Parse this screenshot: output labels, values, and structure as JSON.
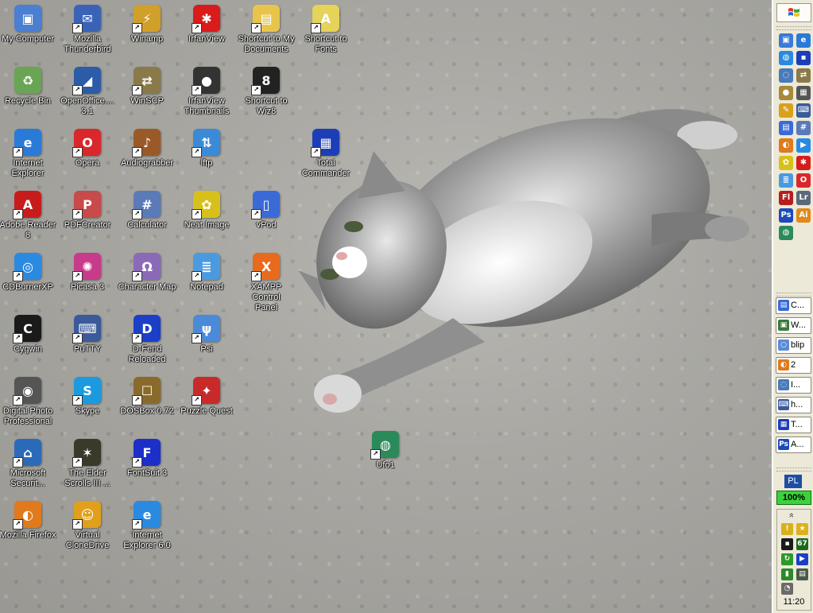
{
  "desktop": {
    "icons": [
      {
        "label": "My Computer",
        "icon": "my-computer-icon",
        "glyph": "▣",
        "color": "#4a7fd1"
      },
      {
        "label": "Mozilla\nThunderbird",
        "icon": "thunderbird-icon",
        "glyph": "✉",
        "color": "#3a63b8"
      },
      {
        "label": "Winamp",
        "icon": "winamp-icon",
        "glyph": "⚡",
        "color": "#d1a02a"
      },
      {
        "label": "IrfanView",
        "icon": "irfanview-icon",
        "glyph": "✱",
        "color": "#d81c1c"
      },
      {
        "label": "Shortcut to My\nDocuments",
        "icon": "folder-icon",
        "glyph": "▤",
        "color": "#e8c54a"
      },
      {
        "label": "Shortcut to\nFonts",
        "icon": "fonts-icon",
        "glyph": "A",
        "color": "#e5d35a"
      },
      {
        "label": "Recycle Bin",
        "icon": "recycle-bin-icon",
        "glyph": "♻",
        "color": "#6aa455"
      },
      {
        "label": "OpenOffice....\n3.1",
        "icon": "openoffice-icon",
        "glyph": "◢",
        "color": "#2c5ca8"
      },
      {
        "label": "WinSCP",
        "icon": "winscp-icon",
        "glyph": "⇄",
        "color": "#8a7a4a"
      },
      {
        "label": "IrfanView\nThumbnails",
        "icon": "panda-icon",
        "glyph": "●",
        "color": "#333333"
      },
      {
        "label": "Shortcut to\nWiz8",
        "icon": "wiz8-icon",
        "glyph": "8",
        "color": "#222222"
      },
      {
        "label": "Internet\nExplorer",
        "icon": "internet-explorer-icon",
        "glyph": "e",
        "color": "#2a7ad8"
      },
      {
        "label": "Opera",
        "icon": "opera-icon",
        "glyph": "O",
        "color": "#d8282c"
      },
      {
        "label": "Audiograbber",
        "icon": "audiograbber-icon",
        "glyph": "♪",
        "color": "#9a5a28"
      },
      {
        "label": "lftp",
        "icon": "lftp-icon",
        "glyph": "⇅",
        "color": "#3a8ad8"
      },
      {
        "label": "Total\nCommander",
        "icon": "total-commander-icon",
        "glyph": "▦",
        "color": "#1c3fb8"
      },
      {
        "label": "Adobe Reader\n8",
        "icon": "adobe-reader-icon",
        "glyph": "A",
        "color": "#c81c1c"
      },
      {
        "label": "PDFCreator",
        "icon": "pdfcreator-icon",
        "glyph": "P",
        "color": "#c84a4a"
      },
      {
        "label": "Calculator",
        "icon": "calculator-icon",
        "glyph": "#",
        "color": "#5a7ab8"
      },
      {
        "label": "Neat Image",
        "icon": "neat-image-icon",
        "glyph": "✿",
        "color": "#d8c01c"
      },
      {
        "label": "vPod",
        "icon": "vpod-icon",
        "glyph": "▯",
        "color": "#3a6ad8"
      },
      {
        "label": "CDBurnerXP",
        "icon": "cdburner-icon",
        "glyph": "◎",
        "color": "#2a8ae0"
      },
      {
        "label": "Picasa 3",
        "icon": "picasa-icon",
        "glyph": "✺",
        "color": "#c83a8a"
      },
      {
        "label": "Character Map",
        "icon": "character-map-icon",
        "glyph": "Ω",
        "color": "#8a6ab8"
      },
      {
        "label": "Notepad",
        "icon": "notepad-icon",
        "glyph": "≣",
        "color": "#4a9ae0"
      },
      {
        "label": "XAMPP Control\nPanel",
        "icon": "xampp-icon",
        "glyph": "X",
        "color": "#e86a1c"
      },
      {
        "label": "Cygwin",
        "icon": "cygwin-icon",
        "glyph": "C",
        "color": "#1a1a1a"
      },
      {
        "label": "PuTTY",
        "icon": "putty-icon",
        "glyph": "⌨",
        "color": "#3a5a9a"
      },
      {
        "label": "D-Fend\nReloaded",
        "icon": "dfend-icon",
        "glyph": "D",
        "color": "#1c3fc8"
      },
      {
        "label": "Psi",
        "icon": "psi-icon",
        "glyph": "ψ",
        "color": "#4a8ad8"
      },
      {
        "label": "Digital Photo\nProfessional",
        "icon": "camera-icon",
        "glyph": "◉",
        "color": "#555555"
      },
      {
        "label": "Skype",
        "icon": "skype-icon",
        "glyph": "S",
        "color": "#1c9ae0"
      },
      {
        "label": "DOSBox 0.72",
        "icon": "dosbox-icon",
        "glyph": "☐",
        "color": "#8a6a2a"
      },
      {
        "label": "Puzzle Quest",
        "icon": "puzzle-quest-icon",
        "glyph": "✦",
        "color": "#c82a2a"
      },
      {
        "label": "Ufo1",
        "icon": "ufo-icon",
        "glyph": "◍",
        "color": "#2a8a5a"
      },
      {
        "label": "Microsoft\nSecurit...",
        "icon": "security-icon",
        "glyph": "⌂",
        "color": "#2a6ab8"
      },
      {
        "label": "The Elder\nScrolls III ...",
        "icon": "elder-scrolls-icon",
        "glyph": "✶",
        "color": "#3a3a2a"
      },
      {
        "label": "FontSuit 3",
        "icon": "fontsuit-icon",
        "glyph": "F",
        "color": "#1c2fc8"
      },
      {
        "label": "Mozilla Firefox",
        "icon": "firefox-icon",
        "glyph": "◐",
        "color": "#e07a1c"
      },
      {
        "label": "Virtual\nCloneDrive",
        "icon": "clonedrive-icon",
        "glyph": "☺",
        "color": "#e0a01c"
      },
      {
        "label": "Internet\nExplorer 6.0",
        "icon": "internet-explorer-icon",
        "glyph": "e",
        "color": "#2a8ae0"
      }
    ]
  },
  "taskbar": {
    "quick_launch": [
      {
        "icon": "show-desktop-icon",
        "glyph": "▣",
        "color": "#3a7ad8"
      },
      {
        "icon": "internet-explorer-icon",
        "glyph": "e",
        "color": "#2a7ad8"
      },
      {
        "icon": "network-icon",
        "glyph": "◍",
        "color": "#2a8ae0"
      },
      {
        "icon": "floppy-icon",
        "glyph": "▪",
        "color": "#1c3fb8"
      },
      {
        "icon": "browser-icon",
        "glyph": "◌",
        "color": "#4a7ab8"
      },
      {
        "icon": "winscp-icon",
        "glyph": "⇄",
        "color": "#8a7a4a"
      },
      {
        "icon": "sphere-icon",
        "glyph": "●",
        "color": "#a8883a"
      },
      {
        "icon": "grid-icon",
        "glyph": "▦",
        "color": "#555555"
      },
      {
        "icon": "pencil-icon",
        "glyph": "✎",
        "color": "#d8a01c"
      },
      {
        "icon": "putty-icon",
        "glyph": "⌨",
        "color": "#3a5a9a"
      },
      {
        "icon": "windows-icon",
        "glyph": "▤",
        "color": "#3a6ad8"
      },
      {
        "icon": "calc-icon",
        "glyph": "#",
        "color": "#5a7ab8"
      },
      {
        "icon": "firefox-icon",
        "glyph": "◐",
        "color": "#e07a1c"
      },
      {
        "icon": "media-icon",
        "glyph": "▶",
        "color": "#2a8ae0"
      },
      {
        "icon": "neat-image-icon",
        "glyph": "✿",
        "color": "#d8c01c"
      },
      {
        "icon": "irfanview-icon",
        "glyph": "✱",
        "color": "#d81c1c"
      },
      {
        "icon": "notepad-icon",
        "glyph": "≣",
        "color": "#4a9ae0"
      },
      {
        "icon": "opera-icon",
        "glyph": "O",
        "color": "#d8282c"
      },
      {
        "icon": "flash-icon",
        "glyph": "Fl",
        "color": "#b81c1c"
      },
      {
        "icon": "lightroom-icon",
        "glyph": "Lr",
        "color": "#5a6a7a"
      },
      {
        "icon": "photoshop-icon",
        "glyph": "Ps",
        "color": "#1c4ab8"
      },
      {
        "icon": "illustrator-icon",
        "glyph": "Ai",
        "color": "#e08a1c"
      },
      {
        "icon": "ufo-icon",
        "glyph": "◍",
        "color": "#2a8a5a"
      }
    ],
    "tasks": [
      {
        "label": "C...",
        "icon": "explorer-icon",
        "glyph": "▤",
        "color": "#3a6ad8"
      },
      {
        "label": "W...",
        "icon": "console-icon",
        "glyph": "▣",
        "color": "#3a7a3a"
      },
      {
        "label": "blip",
        "icon": "chat-icon",
        "glyph": "○",
        "color": "#5a8ad8"
      },
      {
        "label": "2",
        "icon": "firefox-icon",
        "glyph": "◐",
        "color": "#e07a1c"
      },
      {
        "label": "I...",
        "icon": "browser-icon",
        "glyph": "◌",
        "color": "#4a7ab8"
      },
      {
        "label": "h...",
        "icon": "putty-icon",
        "glyph": "⌨",
        "color": "#3a5a9a"
      },
      {
        "label": "T...",
        "icon": "total-commander-icon",
        "glyph": "▦",
        "color": "#1c3fb8"
      },
      {
        "label": "A...",
        "icon": "photoshop-icon",
        "glyph": "Ps",
        "color": "#1c4ab8"
      }
    ],
    "language": "PL",
    "battery": "100%",
    "tray_chevron": "»",
    "tray": [
      {
        "icon": "security-shield-icon",
        "glyph": "!",
        "color": "#d8b01c"
      },
      {
        "icon": "star-icon",
        "glyph": "★",
        "color": "#e0b01c"
      },
      {
        "icon": "cpu-meter-icon",
        "glyph": "▪",
        "color": "#1a1a1a"
      },
      {
        "icon": "cpu-usage-icon",
        "glyph": "67",
        "color": "#1a6a1a"
      },
      {
        "icon": "update-icon",
        "glyph": "↻",
        "color": "#2a9a2a"
      },
      {
        "icon": "play-icon",
        "glyph": "▶",
        "color": "#1c3fc8"
      },
      {
        "icon": "network-signal-icon",
        "glyph": "▮",
        "color": "#2a8a2a"
      },
      {
        "icon": "monitor-icon",
        "glyph": "▤",
        "color": "#4a5a4a"
      },
      {
        "icon": "speaker-icon",
        "glyph": "◔",
        "color": "#6a6a6a"
      }
    ],
    "clock": "11:20"
  }
}
